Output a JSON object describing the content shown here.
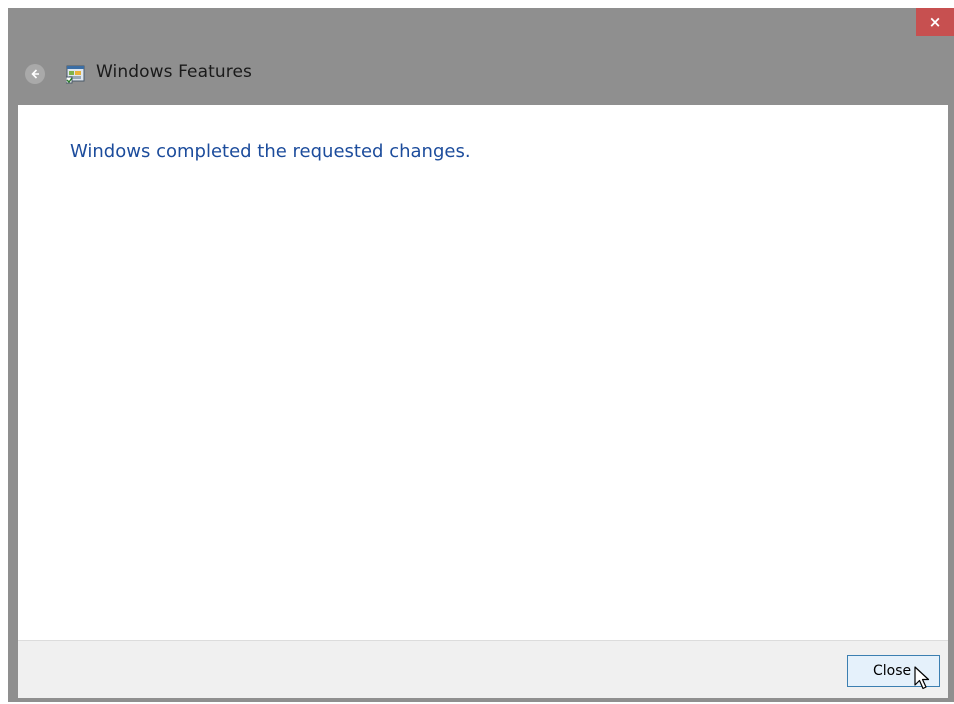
{
  "window": {
    "title": "Windows Features",
    "close_glyph": "×"
  },
  "content": {
    "message": "Windows completed the requested changes."
  },
  "footer": {
    "close_label": "Close"
  },
  "icons": {
    "back": "back-arrow-icon",
    "app": "windows-features-icon",
    "cursor": "mouse-pointer-icon"
  },
  "colors": {
    "titlebar": "#8f8f8f",
    "close_button_bg": "#c75050",
    "message_text": "#1c4c9c",
    "footer_bg": "#f0f0f0",
    "button_bg": "#e5f1fb",
    "button_border": "#3c7fb1"
  }
}
